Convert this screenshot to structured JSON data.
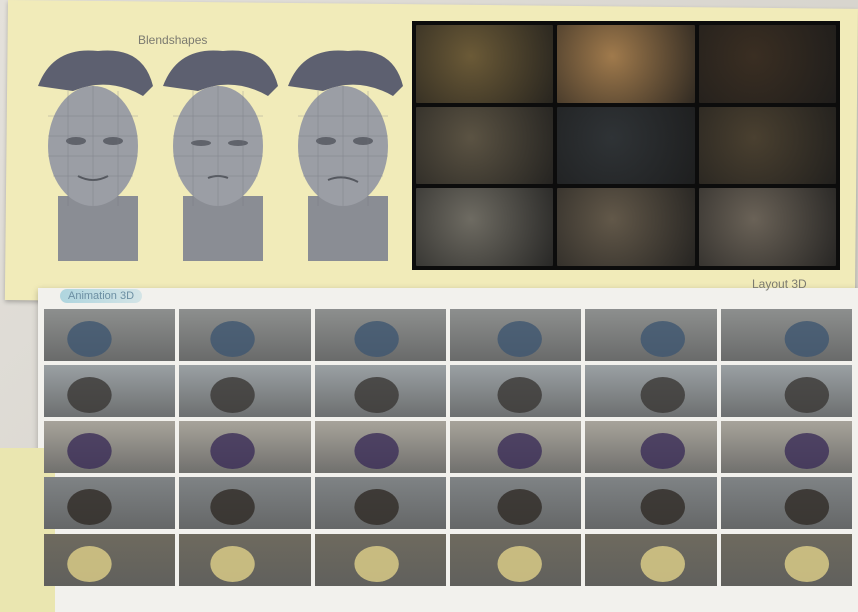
{
  "labels": {
    "blendshapes": "Blendshapes",
    "layout": "Layout 3D",
    "animation": "Animation 3D"
  },
  "layout_cells": [
    {
      "scene": "plants-on-windowsill",
      "color": "#6b5a37"
    },
    {
      "scene": "hand-with-cup",
      "color": "#a07a4c"
    },
    {
      "scene": "dark-kitchen-corner",
      "color": "#3a2e22"
    },
    {
      "scene": "figure-in-attic",
      "color": "#5b5343"
    },
    {
      "scene": "kitchen-at-night",
      "color": "#2f3336"
    },
    {
      "scene": "lamp-lit-room",
      "color": "#4a4030"
    },
    {
      "scene": "bright-window-plant",
      "color": "#6e6b62"
    },
    {
      "scene": "figure-in-kitchen",
      "color": "#625849"
    },
    {
      "scene": "attic-interior",
      "color": "#6a6257"
    }
  ],
  "strips": [
    {
      "name": "strip-toothbrush",
      "bg": "#8d8f8e",
      "accent": "#3e5670",
      "count": 6
    },
    {
      "name": "strip-face-expressions",
      "bg": "#9aa0a3",
      "accent": "#3a3734",
      "count": 6
    },
    {
      "name": "strip-hands-with-cup",
      "bg": "#a7a39a",
      "accent": "#3b2d57",
      "count": 6
    },
    {
      "name": "strip-thinking-pose",
      "bg": "#7f8385",
      "accent": "#2f2a26",
      "count": 6
    },
    {
      "name": "strip-reading-book",
      "bg": "#6e6a5e",
      "accent": "#e0d18a",
      "count": 6
    }
  ]
}
